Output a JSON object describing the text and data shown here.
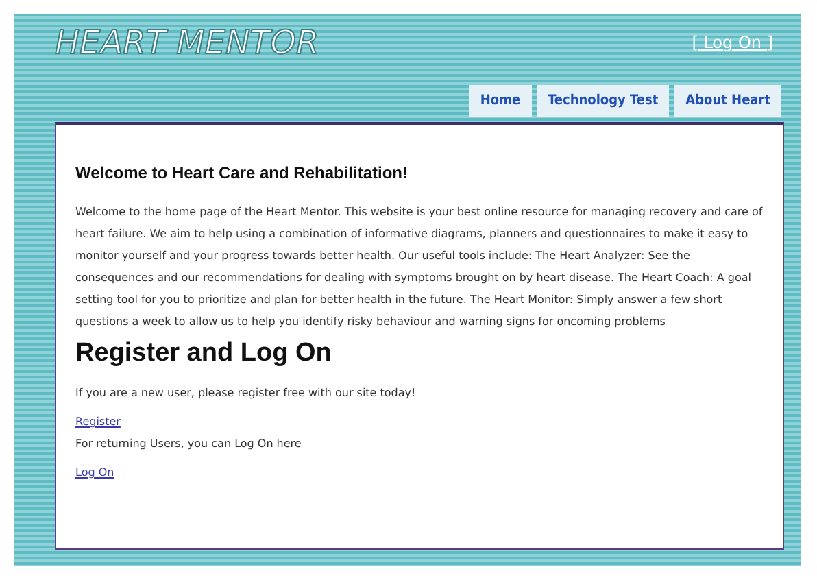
{
  "header": {
    "logo": "HEART MENTOR",
    "login_link": "[ Log On ]"
  },
  "tabs": [
    {
      "label": "Home"
    },
    {
      "label": "Technology Test"
    },
    {
      "label": "About Heart"
    }
  ],
  "content": {
    "welcome_heading": "Welcome to Heart Care and Rehabilitation!",
    "intro": "Welcome to the home page of the Heart Mentor. This website is your best online resource for managing recovery and care of heart failure. We aim to help using a combination of informative diagrams, planners and questionnaires to make it easy to monitor yourself and your progress towards better health. Our useful tools include: The Heart Analyzer: See the consequences and our recommendations for dealing with symptoms brought on by heart disease. The Heart Coach: A goal setting tool for you to prioritize and plan for better health in the future. The Heart Monitor: Simply answer a few short questions a week to allow us to help you identify risky behaviour and warning signs for oncoming problems",
    "register_heading": "Register and Log On",
    "new_user_text": "If you are a new user, please register free with our site today!",
    "register_link": "Register",
    "returning_text": "For returning Users, you can Log On here",
    "login_link": "Log On"
  }
}
